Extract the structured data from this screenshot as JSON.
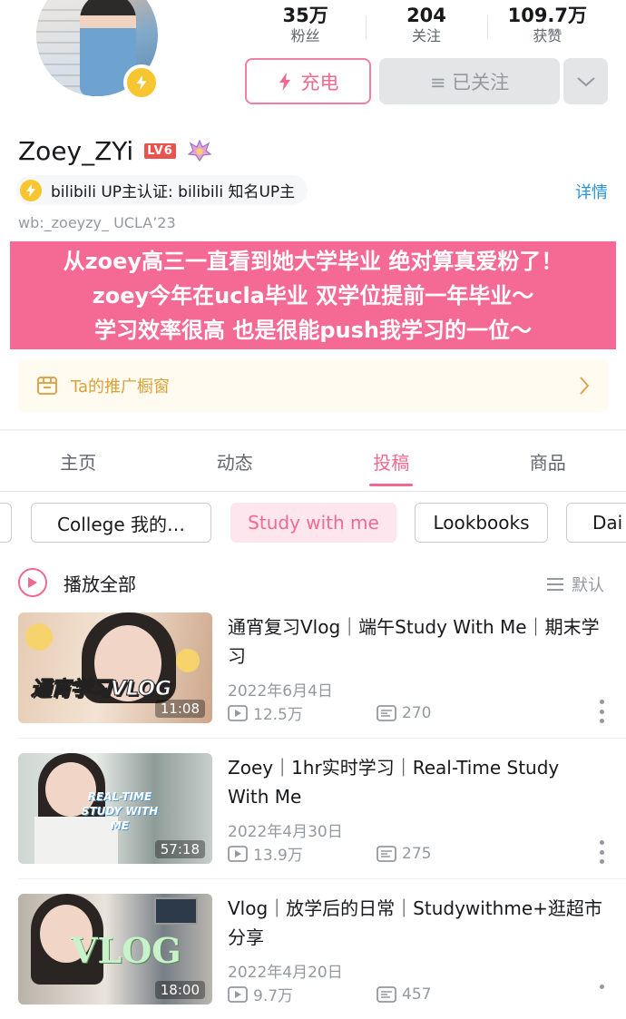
{
  "profile": {
    "name": "Zoey_ZYi",
    "level": "LV6",
    "auth_text": "bilibili UP主认证: bilibili 知名UP主",
    "detail_label": "详情",
    "sign": "wb:_zoeyzy_ UCLA’23",
    "stats": [
      {
        "value": "35万",
        "label": "粉丝"
      },
      {
        "value": "204",
        "label": "关注"
      },
      {
        "value": "109.7万",
        "label": "获赞"
      }
    ],
    "charge_label": "充电",
    "follow_label": "≡ 已关注"
  },
  "banner_lines": [
    "从zoey高三一直看到她大学毕业 绝对算真爱粉了！",
    "zoey今年在ucla毕业 双学位提前一年毕业～",
    "学习效率很高 也是很能push我学习的一位～"
  ],
  "shop_label": "Ta的推广橱窗",
  "tabs": [
    "主页",
    "动态",
    "投稿",
    "商品"
  ],
  "active_tab": "投稿",
  "chips": [
    "College 我的…",
    "Study with me",
    "Lookbooks",
    "Dai"
  ],
  "play_all_label": "播放全部",
  "sort_label": "默认",
  "videos": [
    {
      "title": "通宵复习Vlog｜端午Study With Me｜期末学习",
      "date": "2022年6月4日",
      "views": "12.5万",
      "comments": "270",
      "duration": "11:08",
      "overlay": "通宵学习VLOG"
    },
    {
      "title": "Zoey｜1hr实时学习｜Real-Time Study With Me",
      "date": "2022年4月30日",
      "views": "13.9万",
      "comments": "275",
      "duration": "57:18",
      "overlay": "REAL-TIME STUDY WITH ME"
    },
    {
      "title": "Vlog｜放学后的日常｜Studywithme+逛超市分享",
      "date": "2022年4月20日",
      "views": "9.7万",
      "comments": "457",
      "duration": "18:00",
      "overlay": "VLOG"
    }
  ],
  "colors": {
    "accent": "#f06a8f",
    "banner": "#f56a94",
    "link": "#2a93d8",
    "charge_badge": "#f7c530"
  }
}
